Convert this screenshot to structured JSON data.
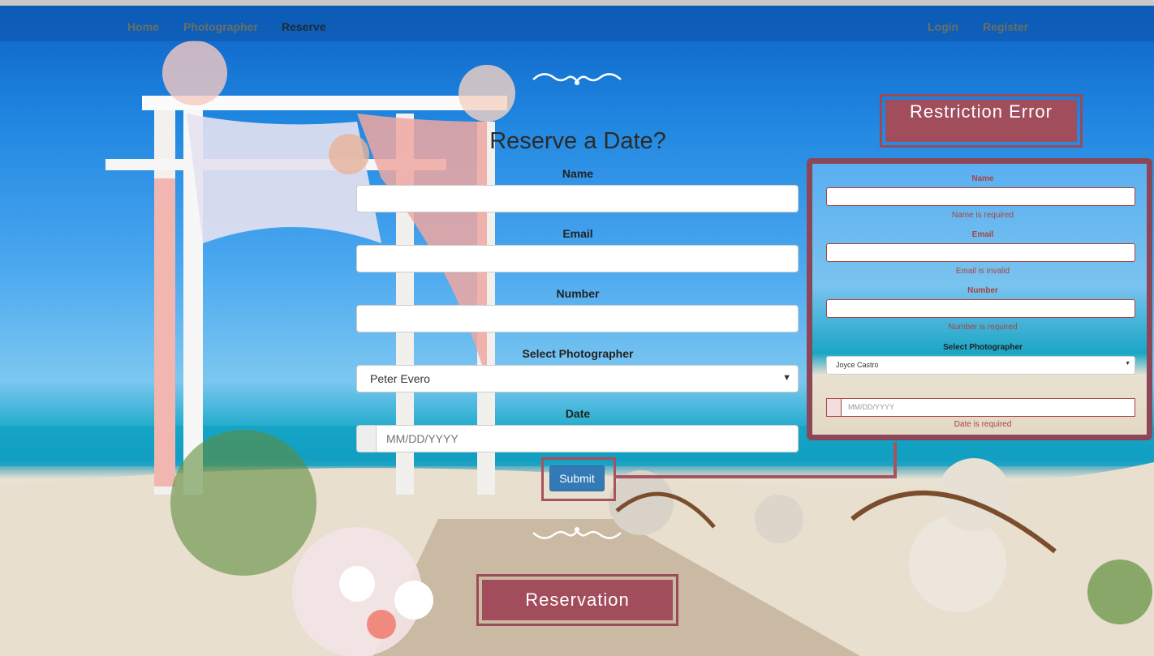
{
  "nav": {
    "home": "Home",
    "photographer": "Photographer",
    "reserve": "Reserve",
    "login": "Login",
    "register": "Register"
  },
  "form": {
    "title": "Reserve a Date?",
    "name_label": "Name",
    "email_label": "Email",
    "number_label": "Number",
    "photographer_label": "Select Photographer",
    "photographer_selected": "Peter Evero",
    "date_label": "Date",
    "date_placeholder": "MM/DD/YYYY",
    "submit_label": "Submit"
  },
  "annotations": {
    "restriction_error": "Restriction Error",
    "reservation": "Reservation"
  },
  "error_panel": {
    "name_label": "Name",
    "name_error": "Name is required",
    "email_label": "Email",
    "email_error": "Email is invalid",
    "number_label": "Number",
    "number_error": "Number is required",
    "photographer_label": "Select Photographer",
    "photographer_selected": "Joyce Castro",
    "date_placeholder": "MM/DD/YYYY",
    "date_error": "Date is required"
  },
  "colors": {
    "callout": "#a14d5c",
    "submit": "#337ab7",
    "error_text": "#a94442"
  }
}
